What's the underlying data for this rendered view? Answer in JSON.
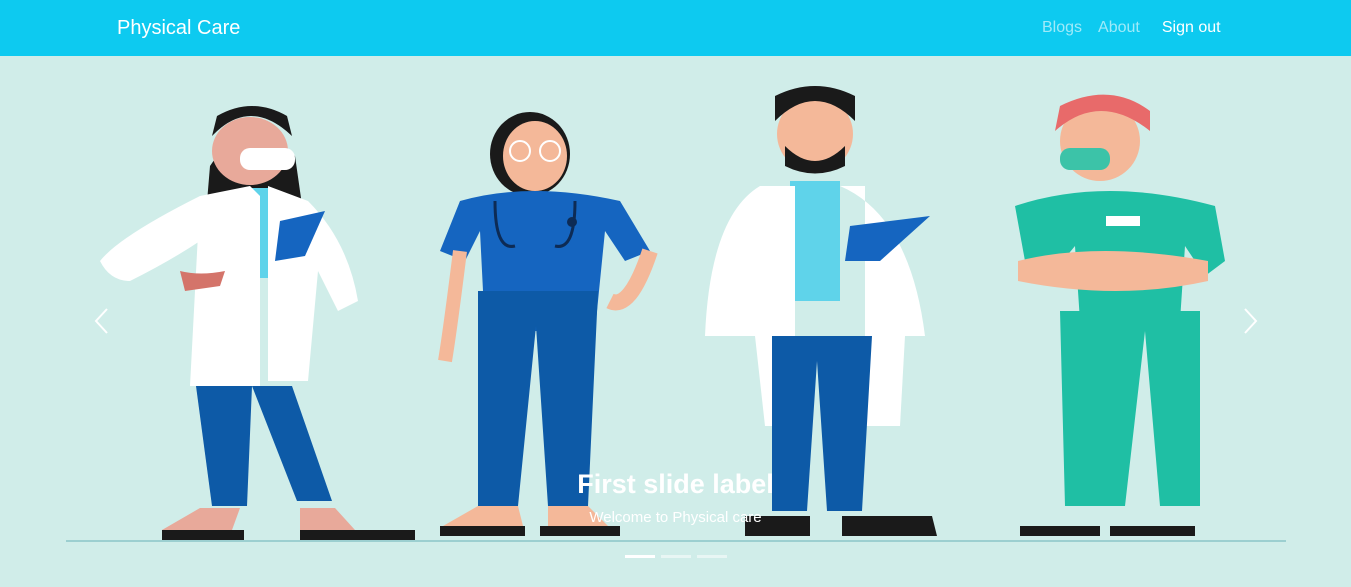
{
  "navbar": {
    "brand": "Physical Care",
    "links": [
      "Blogs",
      "About"
    ],
    "signout": "Sign out",
    "color": "#0dcaf0"
  },
  "carousel": {
    "background": "#d0ede9",
    "caption_title": "First slide label",
    "caption_text": "Welcome to Physical care",
    "indicator_count": 3,
    "active_index": 0
  }
}
